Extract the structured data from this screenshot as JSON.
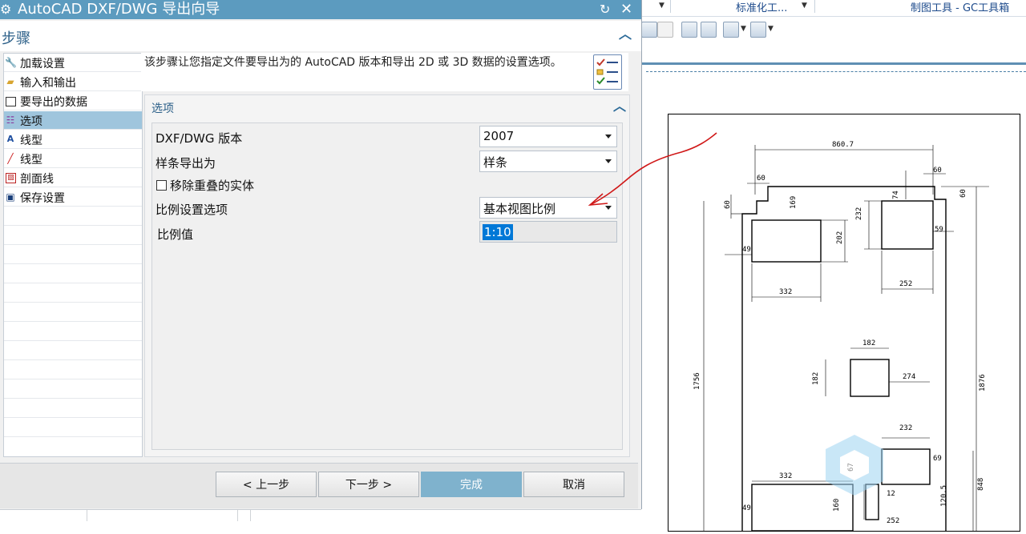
{
  "ribbon": {
    "standardize": "标准化工...",
    "drafting_tools": "制图工具 - GC工具箱"
  },
  "dialog": {
    "title": "AutoCAD DXF/DWG 导出向导",
    "steps_title": "步骤",
    "steps": [
      {
        "label": "加载设置",
        "icon": "wrench-icon"
      },
      {
        "label": "输入和输出",
        "icon": "folder-open-icon"
      },
      {
        "label": "要导出的数据",
        "icon": "window-icon"
      },
      {
        "label": "选项",
        "icon": "options-list-icon",
        "selected": true
      },
      {
        "label": "线型",
        "icon": "linetype-icon"
      },
      {
        "label": "线型",
        "icon": "line-width-icon"
      },
      {
        "label": "剖面线",
        "icon": "hatch-icon"
      },
      {
        "label": "保存设置",
        "icon": "save-icon"
      }
    ],
    "description": "该步骤让您指定文件要导出为的 AutoCAD 版本和导出 2D 或 3D 数据的设置选项。",
    "options_title": "选项",
    "fields": {
      "dxf_version_label": "DXF/DWG 版本",
      "dxf_version_value": "2007",
      "spline_export_label": "样条导出为",
      "spline_export_value": "样条",
      "remove_overlap_label": "移除重叠的实体",
      "remove_overlap_checked": false,
      "scale_option_label": "比例设置选项",
      "scale_option_value": "基本视图比例",
      "scale_value_label": "比例值",
      "scale_value": "1:10"
    },
    "buttons": {
      "back": "< 上一步",
      "next": "下一步 >",
      "finish": "完成",
      "cancel": "取消"
    }
  },
  "drawing": {
    "dimensions": [
      "860.7",
      "60",
      "60",
      "60",
      "169",
      "74",
      "60",
      "232",
      "202",
      "49",
      "59",
      "332",
      "252",
      "182",
      "182",
      "274",
      "1756",
      "1876",
      "232",
      "69",
      "332",
      "67",
      "12",
      "160",
      "49",
      "252",
      "120.5",
      "848"
    ]
  },
  "colors": {
    "titlebar": "#5c9bbf",
    "selected_step": "#9fc5dd",
    "finish_button": "#7fb2cd",
    "annotation_arrow": "#d01818"
  }
}
